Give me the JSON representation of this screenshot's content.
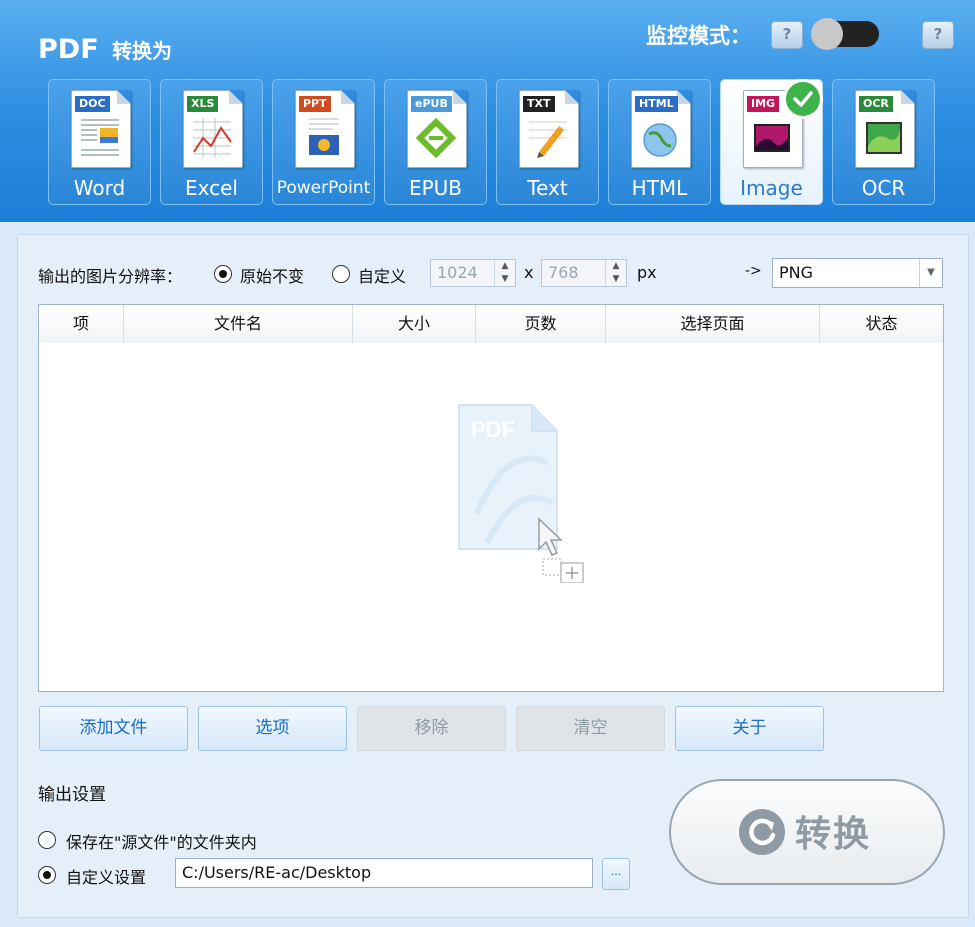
{
  "header": {
    "app_name": "PDF",
    "app_subtitle": "转换为",
    "monitor_label": "监控模式：",
    "help_label": "?",
    "monitor_enabled": false
  },
  "formats": [
    {
      "name": "word",
      "tag": "DOC",
      "label": "Word",
      "active": false,
      "tag_color": "#2b6cc4"
    },
    {
      "name": "excel",
      "tag": "XLS",
      "label": "Excel",
      "active": false,
      "tag_color": "#2a8a3a"
    },
    {
      "name": "powerpoint",
      "tag": "PPT",
      "label": "PowerPoint",
      "active": false,
      "tag_color": "#d04a1f"
    },
    {
      "name": "epub",
      "tag": "ePUB",
      "label": "EPUB",
      "active": false,
      "tag_color": "#4d9ad8"
    },
    {
      "name": "text",
      "tag": "TXT",
      "label": "Text",
      "active": false,
      "tag_color": "#222222"
    },
    {
      "name": "html",
      "tag": "HTML",
      "label": "HTML",
      "active": false,
      "tag_color": "#2b6cc4"
    },
    {
      "name": "image",
      "tag": "IMG",
      "label": "Image",
      "active": true,
      "tag_color": "#c2185b"
    },
    {
      "name": "ocr",
      "tag": "OCR",
      "label": "OCR",
      "active": false,
      "tag_color": "#2a8a3a"
    }
  ],
  "resolution": {
    "label": "输出的图片分辨率：",
    "option_original": "原始不变",
    "option_custom": "自定义",
    "selected": "original",
    "width": "1024",
    "height": "768",
    "x_sep": "x",
    "unit": "px",
    "arrow": "->",
    "format": "PNG"
  },
  "table": {
    "columns": [
      "项",
      "文件名",
      "大小",
      "页数",
      "选择页面",
      "状态"
    ],
    "rows": [],
    "drop_hint_tag": "PDF"
  },
  "buttons": {
    "add_files": "添加文件",
    "options": "选项",
    "remove": "移除",
    "clear": "清空",
    "about": "关于"
  },
  "output": {
    "label": "输出设置",
    "save_in_source": "保存在\"源文件\"的文件夹内",
    "custom_label": "自定义设置",
    "selected": "custom",
    "path": "C:/Users/RE-ac/Desktop",
    "browse_label": "..."
  },
  "convert": {
    "label": "转换"
  },
  "colors": {
    "header_blue": "#2a8ce0",
    "accent_blue": "#1a6ec8",
    "check_green": "#3db34a"
  }
}
